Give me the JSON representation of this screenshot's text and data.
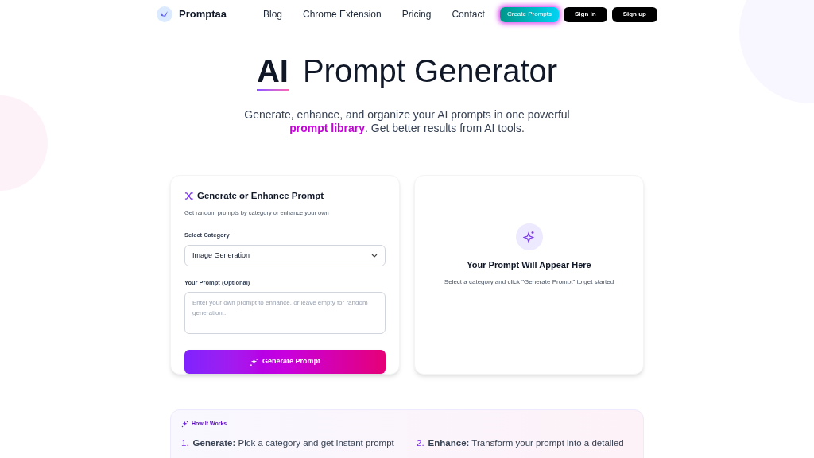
{
  "nav": {
    "brand": "Promptaa",
    "links": [
      "Blog",
      "Chrome Extension",
      "Pricing",
      "Contact"
    ],
    "buttons": [
      {
        "label": "Create Prompts",
        "kind": "gradient"
      },
      {
        "label": "Sign in",
        "kind": "dark"
      },
      {
        "label": "Sign up",
        "kind": "dark"
      }
    ]
  },
  "hero": {
    "title_bold": "AI",
    "title_rest": "Prompt Generator",
    "subtitle_before": "Generate, enhance, and organize your AI prompts in one powerful",
    "subtitle_link": "prompt library",
    "subtitle_after": ". Get better results from AI tools."
  },
  "generator": {
    "title": "Generate or Enhance Prompt",
    "description": "Get random prompts by category or enhance your own",
    "category_label": "Select Category",
    "category_value": "Image Generation",
    "prompt_label": "Your Prompt (Optional)",
    "prompt_placeholder": "Enter your own prompt to enhance, or leave empty for random generation...",
    "button": "Generate Prompt"
  },
  "output": {
    "title": "Your Prompt Will Appear Here",
    "hint": "Select a category and click \"Generate Prompt\" to get started"
  },
  "how_it_works": {
    "title": "How It Works",
    "steps": [
      {
        "number": "1.",
        "text": "**Generate:** Pick a category and get instant prompt"
      },
      {
        "number": "2.",
        "text": "**Enhance:** Transform your prompt into a detailed"
      }
    ]
  }
}
